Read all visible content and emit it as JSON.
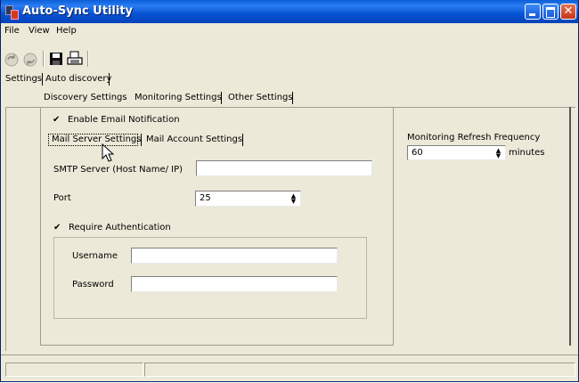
{
  "window": {
    "title": "Auto-Sync Utility"
  },
  "menu": {
    "items": [
      "File",
      "View",
      "Help"
    ]
  },
  "tabs": {
    "top": [
      "Settings",
      "Auto discovery"
    ],
    "sub": [
      "Discovery Settings",
      "Monitoring Settings",
      "Other Settings"
    ],
    "mail": [
      "Mail Server Settings",
      "Mail Account Settings"
    ]
  },
  "monitoring": {
    "enable_email_label": "Enable Email Notification",
    "enable_email_checked": true,
    "smtp_label": "SMTP Server (Host Name/ IP)",
    "smtp_value": "",
    "port_label": "Port",
    "port_value": "25",
    "require_auth_label": "Require Authentication",
    "require_auth_checked": true,
    "username_label": "Username",
    "username_value": "",
    "password_label": "Password",
    "password_value": ""
  },
  "refresh": {
    "label": "Monitoring Refresh Frequency",
    "value": "60",
    "unit": "minutes"
  },
  "icons": [
    "app-icon",
    "start-sync-icon",
    "stop-sync-icon",
    "save-icon",
    "print-icon",
    "cursor-arrow-icon"
  ]
}
